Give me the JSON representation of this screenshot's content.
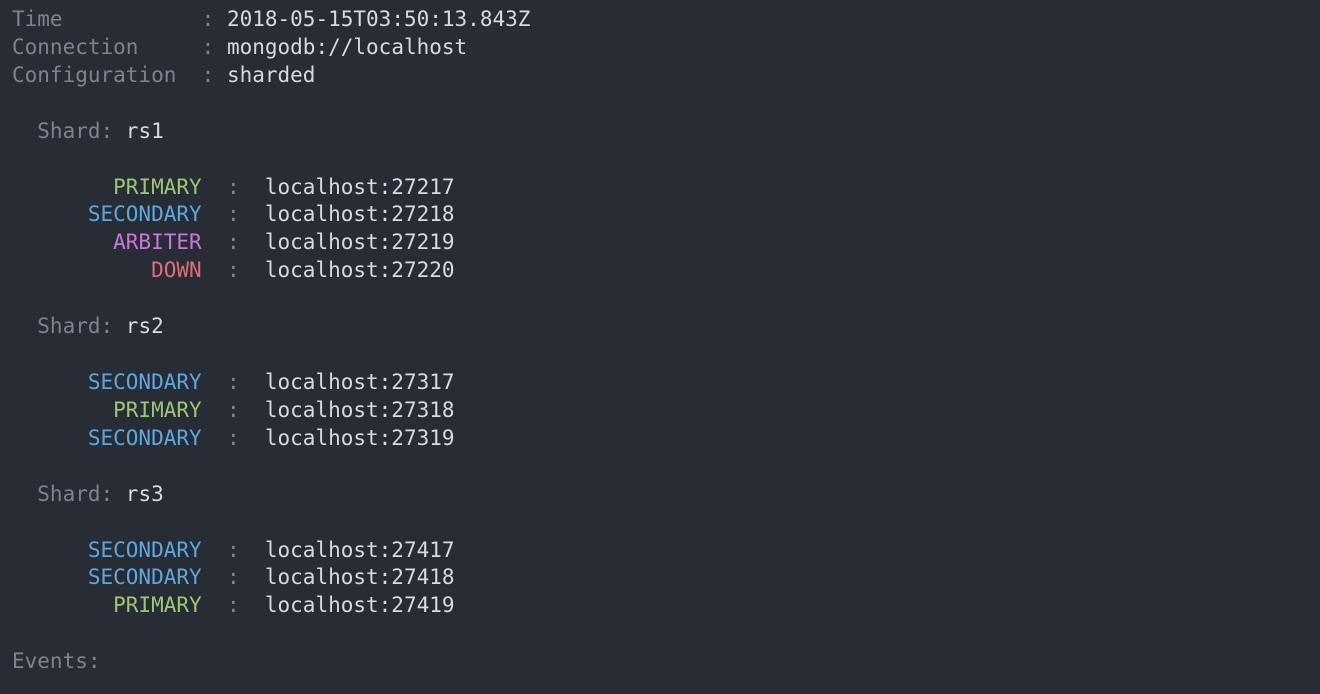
{
  "header": {
    "time_label": "Time",
    "time_value": "2018-05-15T03:50:13.843Z",
    "connection_label": "Connection",
    "connection_value": "mongodb://localhost",
    "configuration_label": "Configuration",
    "configuration_value": "sharded"
  },
  "shard_label": "Shard:",
  "separator": ":",
  "shards": [
    {
      "name": "rs1",
      "members": [
        {
          "role": "PRIMARY",
          "host": "localhost:27217"
        },
        {
          "role": "SECONDARY",
          "host": "localhost:27218"
        },
        {
          "role": "ARBITER",
          "host": "localhost:27219"
        },
        {
          "role": "DOWN",
          "host": "localhost:27220"
        }
      ]
    },
    {
      "name": "rs2",
      "members": [
        {
          "role": "SECONDARY",
          "host": "localhost:27317"
        },
        {
          "role": "PRIMARY",
          "host": "localhost:27318"
        },
        {
          "role": "SECONDARY",
          "host": "localhost:27319"
        }
      ]
    },
    {
      "name": "rs3",
      "members": [
        {
          "role": "SECONDARY",
          "host": "localhost:27417"
        },
        {
          "role": "SECONDARY",
          "host": "localhost:27418"
        },
        {
          "role": "PRIMARY",
          "host": "localhost:27419"
        }
      ]
    }
  ],
  "events_label": "Events:",
  "colors": {
    "background": "#282c34",
    "default": "#d7dae0",
    "dim": "#7f838e",
    "primary": "#9cc777",
    "secondary": "#5ea8e0",
    "arbiter": "#c678dd",
    "down": "#e06c75"
  }
}
